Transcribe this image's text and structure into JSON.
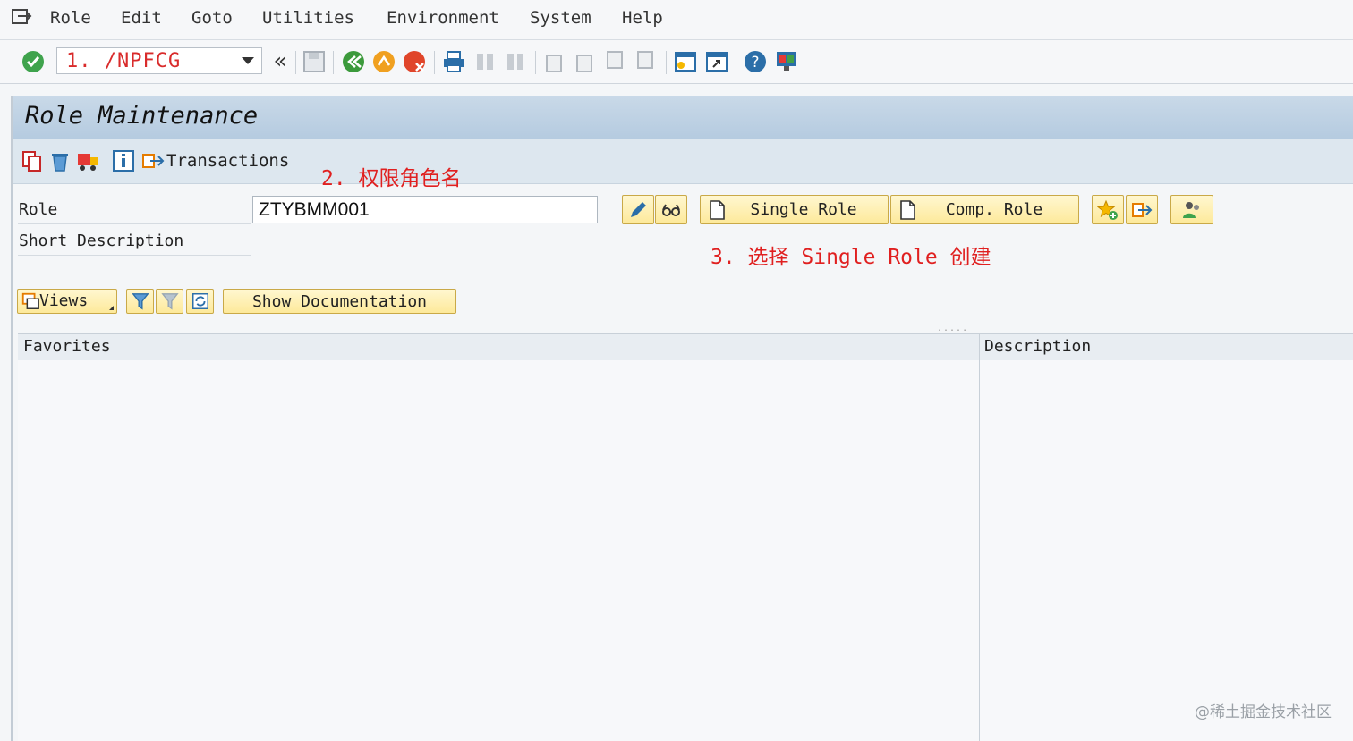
{
  "menu": {
    "items": [
      "Role",
      "Edit",
      "Goto",
      "Utilities",
      "Environment",
      "System",
      "Help"
    ]
  },
  "toolbar": {
    "command_value": "1. /NPFCG",
    "back_label": "«"
  },
  "title": "Role Maintenance",
  "app_toolbar": {
    "transactions_label": "Transactions"
  },
  "annotations": {
    "step2": "2. 权限角色名",
    "step3": "3. 选择 Single Role 创建"
  },
  "form": {
    "role_label": "Role",
    "role_value": "ZTYBMM001",
    "short_desc_label": "Short Description"
  },
  "buttons": {
    "single_role": "Single Role",
    "comp_role": "Comp. Role",
    "views": "Views",
    "show_documentation": "Show Documentation"
  },
  "grid": {
    "col_favorites": "Favorites",
    "col_description": "Description"
  },
  "watermark": "@稀土掘金技术社区",
  "colors": {
    "annotation": "#e02020",
    "title_bar": "#c9d9e8",
    "button_bg": "#fde99a"
  }
}
